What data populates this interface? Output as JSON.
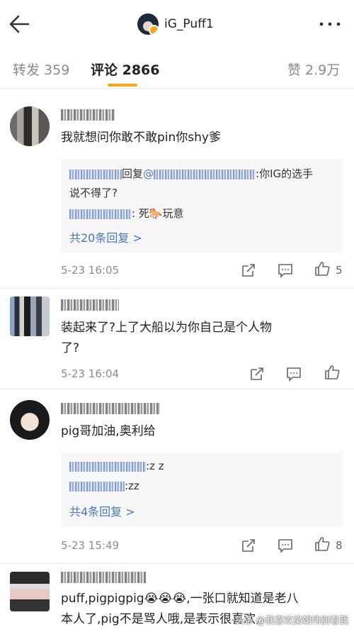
{
  "header": {
    "title": "iG_Puff1",
    "back_icon": "arrow-left-icon",
    "more_icon": "more-dots-icon"
  },
  "tabs": [
    {
      "label": "转发 359",
      "active": false
    },
    {
      "label": "评论 2866",
      "active": true
    },
    {
      "label": "赞 2.9万",
      "active": false
    }
  ],
  "accent": "#f5a623",
  "link_color": "#4a78b8",
  "comments": [
    {
      "text": "我就想问你敢不敢pin你shy爹",
      "replies": [
        {
          "prefix": "回复",
          "mention": "@",
          "text_line1": ":你IG的选手",
          "text_line2": "说不得了?"
        },
        {
          "text": ": 死",
          "emoji": "🐎",
          "text_after": "玩意"
        }
      ],
      "more_replies": "共20条回复 >",
      "time": "5-23 16:05",
      "likes": "5"
    },
    {
      "text_line1": "装起来了?上了大船以为你自己是个人物",
      "text_line2": "了?",
      "time": "5-23 16:04",
      "likes": ""
    },
    {
      "text": "pig哥加油,奥利给",
      "replies": [
        {
          "text": ":z z"
        },
        {
          "text": ":zz"
        }
      ],
      "more_replies": "共4条回复 >",
      "time": "5-23 15:49",
      "likes": "8"
    },
    {
      "text_line1": "puff,pigpigpig😭😭😭,一张口就知道是老八",
      "text_line2": "本人了,pig不是骂人哦,是表示很喜欢,"
    }
  ],
  "watermark": "头条 @我喜欢梁朝伟别看我"
}
